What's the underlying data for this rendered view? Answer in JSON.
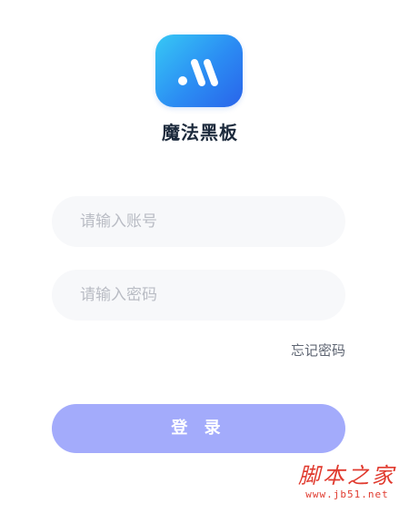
{
  "app": {
    "name": "魔法黑板",
    "logo_icon": "app-logo-icon",
    "logo_colors": [
      "#37c8f5",
      "#2b8cf3",
      "#2a64ea"
    ]
  },
  "form": {
    "account_placeholder": "请输入账号",
    "account_value": "",
    "password_placeholder": "请输入密码",
    "password_value": "",
    "forgot_password": "忘记密码",
    "login_label": "登 录",
    "login_color": "#a3abfb"
  },
  "watermark": {
    "text": "脚本之家",
    "url": "www.jb51.net",
    "color": "#e03a2e"
  }
}
